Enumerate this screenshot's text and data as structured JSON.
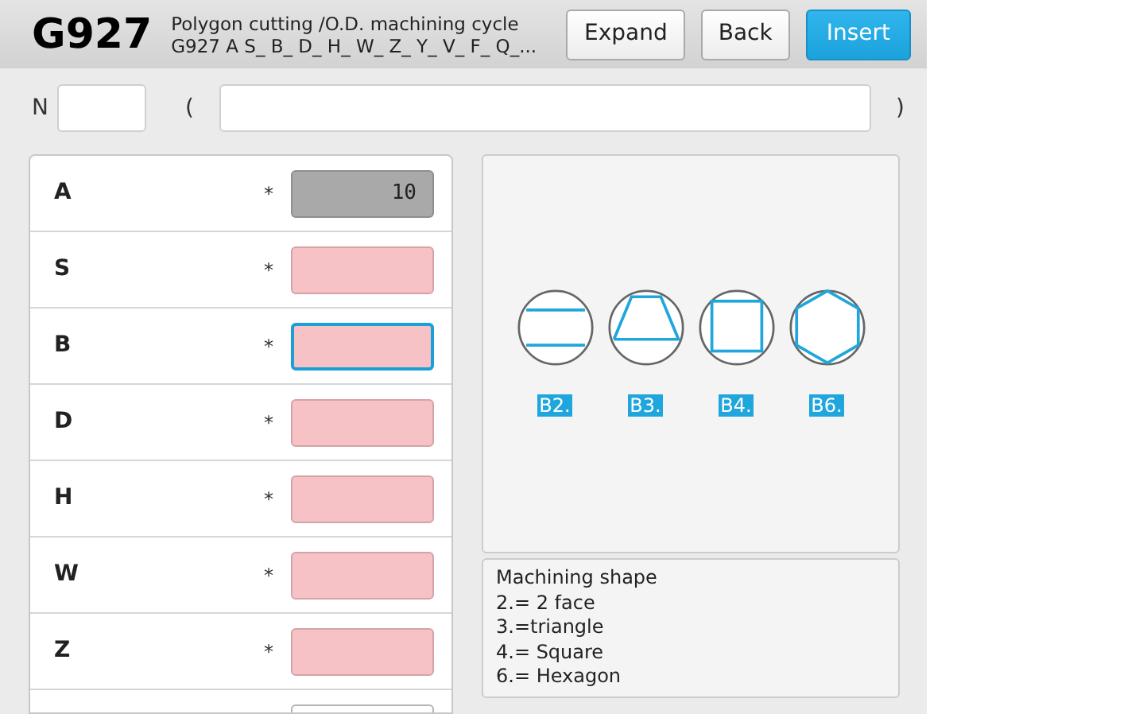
{
  "header": {
    "code": "G927",
    "title": "Polygon cutting /O.D. machining cycle",
    "syntax": "G927 A S_ B_ D_ H_ W_ Z_ Y_ V_ F_ Q_...",
    "buttons": [
      {
        "label": "Expand",
        "kind": "normal"
      },
      {
        "label": "Back",
        "kind": "normal"
      },
      {
        "label": "Insert",
        "kind": "primary"
      }
    ]
  },
  "sequence": {
    "label": "N",
    "open_paren": "(",
    "close_paren": ")"
  },
  "params": [
    {
      "label": "A",
      "mark": "*",
      "kind": "fixed",
      "value": "10",
      "focused": false
    },
    {
      "label": "S",
      "mark": "*",
      "kind": "required",
      "focused": false
    },
    {
      "label": "B",
      "mark": "*",
      "kind": "required",
      "focused": true
    },
    {
      "label": "D",
      "mark": "*",
      "kind": "required",
      "focused": false
    },
    {
      "label": "H",
      "mark": "*",
      "kind": "required",
      "focused": false
    },
    {
      "label": "W",
      "mark": "*",
      "kind": "required",
      "focused": false
    },
    {
      "label": "Z",
      "mark": "*",
      "kind": "required",
      "focused": false
    },
    {
      "kind": "optional",
      "focused": false
    }
  ],
  "shapes": [
    {
      "kind": "two_face",
      "label": "B2."
    },
    {
      "kind": "triangle",
      "label": "B3."
    },
    {
      "kind": "square",
      "label": "B4."
    },
    {
      "kind": "hexagon",
      "label": "B6."
    }
  ],
  "description": [
    "Machining shape",
    "2.= 2 face",
    "3.=triangle",
    "4.= Square",
    "6.= Hexagon"
  ]
}
